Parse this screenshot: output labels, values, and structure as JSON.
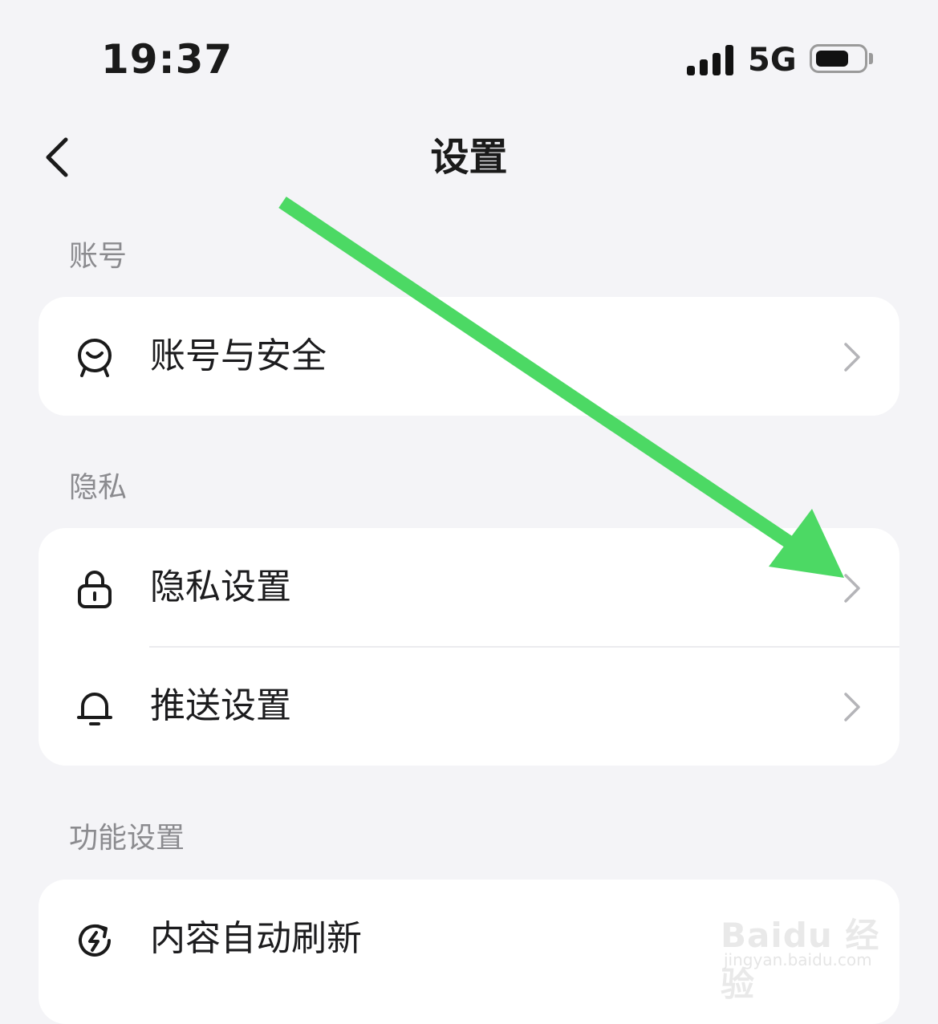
{
  "status_bar": {
    "time": "19:37",
    "network": "5G",
    "signal_bars": 4,
    "battery_level": 0.7
  },
  "nav": {
    "back_icon": "chevron-left-icon",
    "title": "设置"
  },
  "sections": [
    {
      "label": "账号",
      "items": [
        {
          "label": "账号与安全",
          "icon": "account-face-icon"
        }
      ]
    },
    {
      "label": "隐私",
      "items": [
        {
          "label": "隐私设置",
          "icon": "lock-icon"
        },
        {
          "label": "推送设置",
          "icon": "bell-icon"
        }
      ]
    },
    {
      "label": "功能设置",
      "items": [
        {
          "label": "内容自动刷新",
          "icon": "refresh-bolt-icon"
        }
      ]
    }
  ],
  "annotation": {
    "arrow_color": "#4cd964"
  },
  "watermark": {
    "logo": "Baidu 经验",
    "url": "jingyan.baidu.com"
  }
}
